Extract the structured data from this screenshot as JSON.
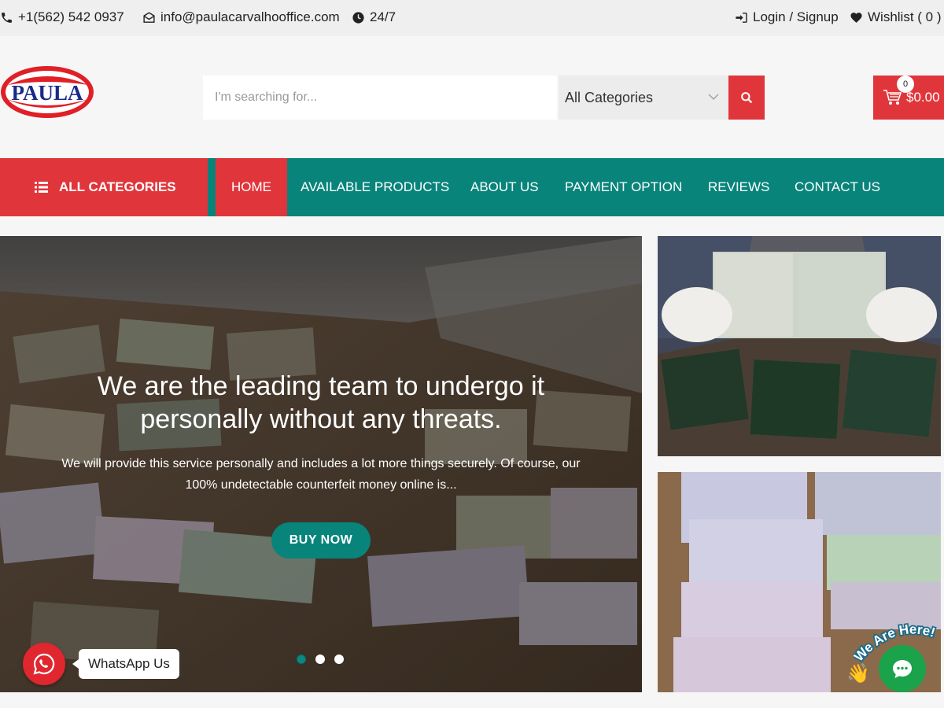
{
  "topbar": {
    "phone": "+1(562) 542 0937",
    "email": "info@paulacarvalhooffice.com",
    "hours": "24/7",
    "login": "Login / Signup",
    "wishlist": "Wishlist ( 0 )"
  },
  "header": {
    "logo_text": "PAULA",
    "search_placeholder": "I'm searching for...",
    "category_selected": "All Categories",
    "cart_count": "0",
    "cart_total": "$0.00"
  },
  "nav": {
    "all_categories": "ALL CATEGORIES",
    "links": [
      "HOME",
      "AVAILABLE PRODUCTS",
      "ABOUT US",
      "PAYMENT OPTION",
      "REVIEWS",
      "CONTACT US"
    ],
    "active": "HOME"
  },
  "hero": {
    "title": "We are the leading team to undergo it personally without any threats.",
    "subtitle": "We will provide this service personally and includes a lot more things securely. Of course, our 100% undetectable counterfeit money online is...",
    "button": "BUY NOW",
    "slides": 3,
    "active_slide": 1
  },
  "widgets": {
    "whatsapp_label": "WhatsApp Us",
    "chat_tagline": "We Are Here!"
  },
  "colors": {
    "red": "#e0363b",
    "teal": "#08847b",
    "topbar_bg": "#efefef"
  }
}
